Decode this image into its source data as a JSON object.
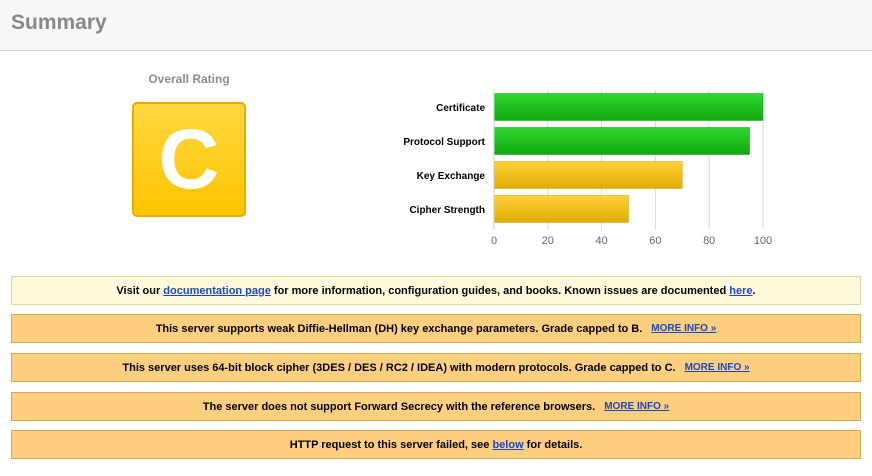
{
  "summary": {
    "title": "Summary"
  },
  "rating": {
    "label": "Overall Rating",
    "grade": "C",
    "grade_color": "#ffc400"
  },
  "chart_data": {
    "type": "bar",
    "orientation": "horizontal",
    "categories": [
      "Certificate",
      "Protocol Support",
      "Key Exchange",
      "Cipher Strength"
    ],
    "values": [
      100,
      95,
      70,
      50
    ],
    "colors": [
      "#1fbe1f",
      "#1fbe1f",
      "#eebb10",
      "#eebb10"
    ],
    "xlim": [
      0,
      100
    ],
    "xticks": [
      0,
      20,
      40,
      60,
      80,
      100
    ],
    "grid": true
  },
  "notices": [
    {
      "type": "info",
      "parts": [
        "Visit our ",
        "documentation page",
        " for more information, configuration guides, and books. Known issues are documented ",
        "here",
        "."
      ]
    },
    {
      "type": "warn",
      "text": "This server supports weak Diffie-Hellman (DH) key exchange parameters. Grade capped to B.",
      "link": "MORE INFO »"
    },
    {
      "type": "warn",
      "text": "This server uses 64-bit block cipher (3DES / DES / RC2 / IDEA) with modern protocols. Grade capped to C.",
      "link": "MORE INFO »"
    },
    {
      "type": "warn",
      "text": "The server does not support Forward Secrecy with the reference browsers.",
      "link": "MORE INFO »"
    },
    {
      "type": "warn",
      "parts": [
        "HTTP request to this server failed, see ",
        "below",
        " for details."
      ]
    }
  ]
}
